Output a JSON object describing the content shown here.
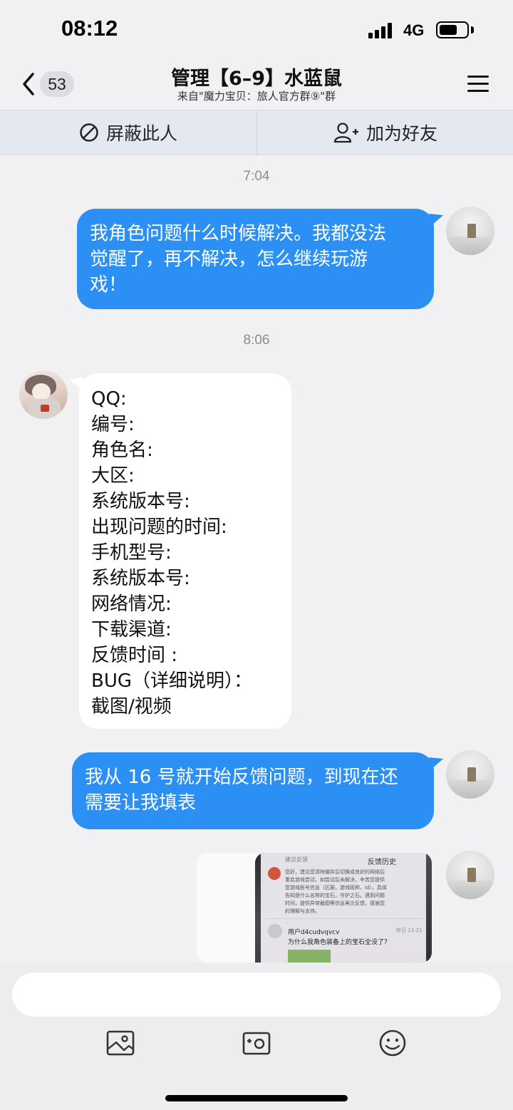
{
  "status": {
    "time": "08:12",
    "network": "4G"
  },
  "nav": {
    "back_count": "53",
    "title": "管理【6–9】水蓝鼠",
    "subtitle": "来自\"魔力宝贝：旅人官方群⑨\"群"
  },
  "actions": {
    "block_label": "屏蔽此人",
    "add_friend_label": "加为好友"
  },
  "messages": {
    "t1": "7:04",
    "m1": [
      "我角色问题什么时候解决。我都没法",
      "觉醒了，再不解决，怎么继续玩游",
      "戏！"
    ],
    "t2": "8:06",
    "m2": [
      "QQ:",
      "编号:",
      "角色名:",
      "大区:",
      "系统版本号:",
      "出现问题的时间:",
      "手机型号:",
      "系统版本号:",
      "网络情况:",
      "下载渠道:",
      "反馈时间 :",
      "BUG（详细说明）：",
      "截图/视频"
    ],
    "m3": [
      "我从 16 号就开始反馈问题，到现在还",
      "需要让我填表"
    ],
    "image": {
      "screen_title": "反馈历史",
      "screen_tab": "建议反馈",
      "reply_lines": [
        "您好，建议您清除缓存后切换成良好的网络后",
        "重启游戏尝试，如尝试后未解决，辛苦您提供",
        "您游戏账号信息（区服，游戏昵称，id），具体",
        "告知是什么名称的宝石，守护之石。遇到问题",
        "时间，提供异常截图等信息再次反馈，感谢您",
        "的理解与支持。"
      ],
      "user": "用户d4cudvqvcv",
      "date": "昨日 13:21",
      "question": "为什么我角色装备上的宝石全没了？"
    }
  },
  "colors": {
    "bubble_blue": "#2b8ff3",
    "background": "#f1f1f3",
    "action_bar": "#e4e9f1"
  },
  "icons": [
    "back-chevron-icon",
    "menu-icon",
    "block-icon",
    "add-friend-icon",
    "image-icon",
    "camera-icon",
    "emoji-icon"
  ]
}
